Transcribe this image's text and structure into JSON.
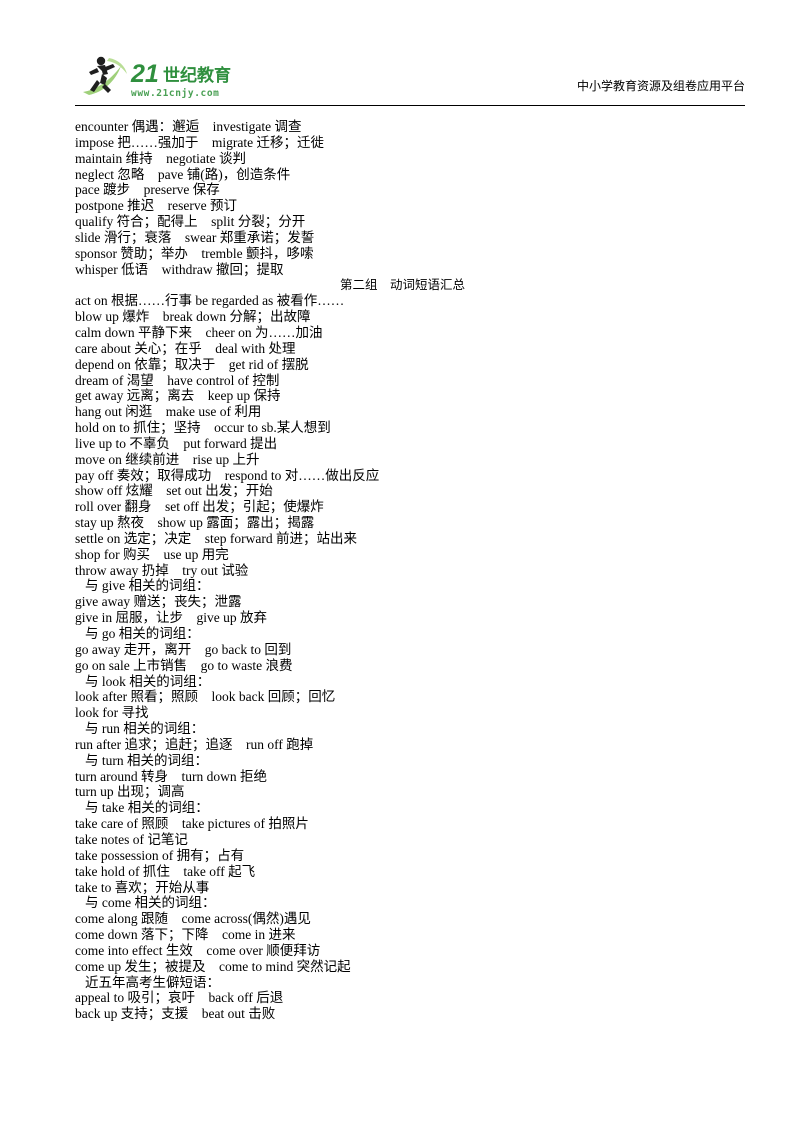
{
  "header": {
    "logo": {
      "brand_text": "21世纪教育",
      "brand_number": "21",
      "brand_cn": "世纪教育",
      "url": "www.21cnjy.com",
      "icon": "running-figure-icon",
      "colors": {
        "dark_green": "#1e6b32",
        "mid_green": "#3f9c4f",
        "light_green": "#8dc63f",
        "pale_green": "#c9e4a0"
      }
    },
    "platform_text": "中小学教育资源及组卷应用平台"
  },
  "group_title": "第二组　动词短语汇总",
  "vocab_lines": [
    "encounter 偶遇：邂逅　investigate 调查",
    "impose 把……强加于　migrate 迁移；迁徙",
    "maintain 维持　negotiate 谈判",
    "neglect 忽略　pave 铺(路)，创造条件",
    "pace 踱步　preserve 保存",
    "postpone 推迟　reserve 预订",
    "qualify 符合；配得上　split 分裂；分开",
    "slide 滑行；衰落　swear 郑重承诺；发誓",
    "sponsor 赞助；举办　tremble 颤抖，哆嗦",
    "whisper 低语　withdraw 撤回；提取"
  ],
  "phrase_lines": [
    {
      "indent": false,
      "text": "act on 根据……行事 be regarded as 被看作……"
    },
    {
      "indent": false,
      "text": "blow up 爆炸　break down 分解；出故障"
    },
    {
      "indent": false,
      "text": "calm down 平静下来　cheer on 为……加油"
    },
    {
      "indent": false,
      "text": "care about 关心；在乎　deal with 处理"
    },
    {
      "indent": false,
      "text": "depend on 依靠；取决于　get rid of 摆脱"
    },
    {
      "indent": false,
      "text": "dream of 渴望　have control of 控制"
    },
    {
      "indent": false,
      "text": "get away 远离；离去　keep up 保持"
    },
    {
      "indent": false,
      "text": "hang out 闲逛　make use of 利用"
    },
    {
      "indent": false,
      "text": "hold on to 抓住；坚持　occur to sb.某人想到"
    },
    {
      "indent": false,
      "text": "live up to 不辜负　put forward 提出"
    },
    {
      "indent": false,
      "text": "move on 继续前进　rise up 上升"
    },
    {
      "indent": false,
      "text": "pay off 奏效；取得成功　respond to 对……做出反应"
    },
    {
      "indent": false,
      "text": "show off 炫耀　set out 出发；开始"
    },
    {
      "indent": false,
      "text": "roll over 翻身　set off 出发；引起；使爆炸"
    },
    {
      "indent": false,
      "text": "stay up 熬夜　show up 露面；露出；揭露"
    },
    {
      "indent": false,
      "text": "settle on 选定；决定　step forward 前进；站出来"
    },
    {
      "indent": false,
      "text": "shop for 购买　use up 用完"
    },
    {
      "indent": false,
      "text": "throw away 扔掉　try out 试验"
    },
    {
      "indent": true,
      "text": "与 give 相关的词组："
    },
    {
      "indent": false,
      "text": "give away 赠送；丧失；泄露"
    },
    {
      "indent": false,
      "text": "give in 屈服，让步　give up 放弃"
    },
    {
      "indent": true,
      "text": "与 go 相关的词组："
    },
    {
      "indent": false,
      "text": "go away 走开，离开　go back to 回到"
    },
    {
      "indent": false,
      "text": "go on sale 上市销售　go to waste 浪费"
    },
    {
      "indent": true,
      "text": "与 look 相关的词组："
    },
    {
      "indent": false,
      "text": "look after 照看；照顾　look back 回顾；回忆"
    },
    {
      "indent": false,
      "text": "look for 寻找"
    },
    {
      "indent": true,
      "text": "与 run 相关的词组："
    },
    {
      "indent": false,
      "text": "run after 追求；追赶；追逐　run off 跑掉"
    },
    {
      "indent": true,
      "text": "与 turn 相关的词组："
    },
    {
      "indent": false,
      "text": "turn around 转身　turn down 拒绝"
    },
    {
      "indent": false,
      "text": "turn up 出现；调高"
    },
    {
      "indent": true,
      "text": "与 take 相关的词组："
    },
    {
      "indent": false,
      "text": "take care of 照顾　take pictures of 拍照片"
    },
    {
      "indent": false,
      "text": "take notes of 记笔记"
    },
    {
      "indent": false,
      "text": "take possession of 拥有；占有"
    },
    {
      "indent": false,
      "text": "take hold of 抓住　take off 起飞"
    },
    {
      "indent": false,
      "text": "take to 喜欢；开始从事"
    },
    {
      "indent": true,
      "text": "与 come 相关的词组："
    },
    {
      "indent": false,
      "text": "come along 跟随　come across(偶然)遇见"
    },
    {
      "indent": false,
      "text": "come down 落下；下降　come in 进来"
    },
    {
      "indent": false,
      "text": "come into effect 生效　come over 顺便拜访"
    },
    {
      "indent": false,
      "text": "come up 发生；被提及　come to mind 突然记起"
    },
    {
      "indent": true,
      "text": "近五年高考生僻短语："
    },
    {
      "indent": false,
      "text": "appeal to 吸引；哀吁　back off 后退"
    },
    {
      "indent": false,
      "text": "back up 支持；支援　beat out 击败"
    }
  ]
}
